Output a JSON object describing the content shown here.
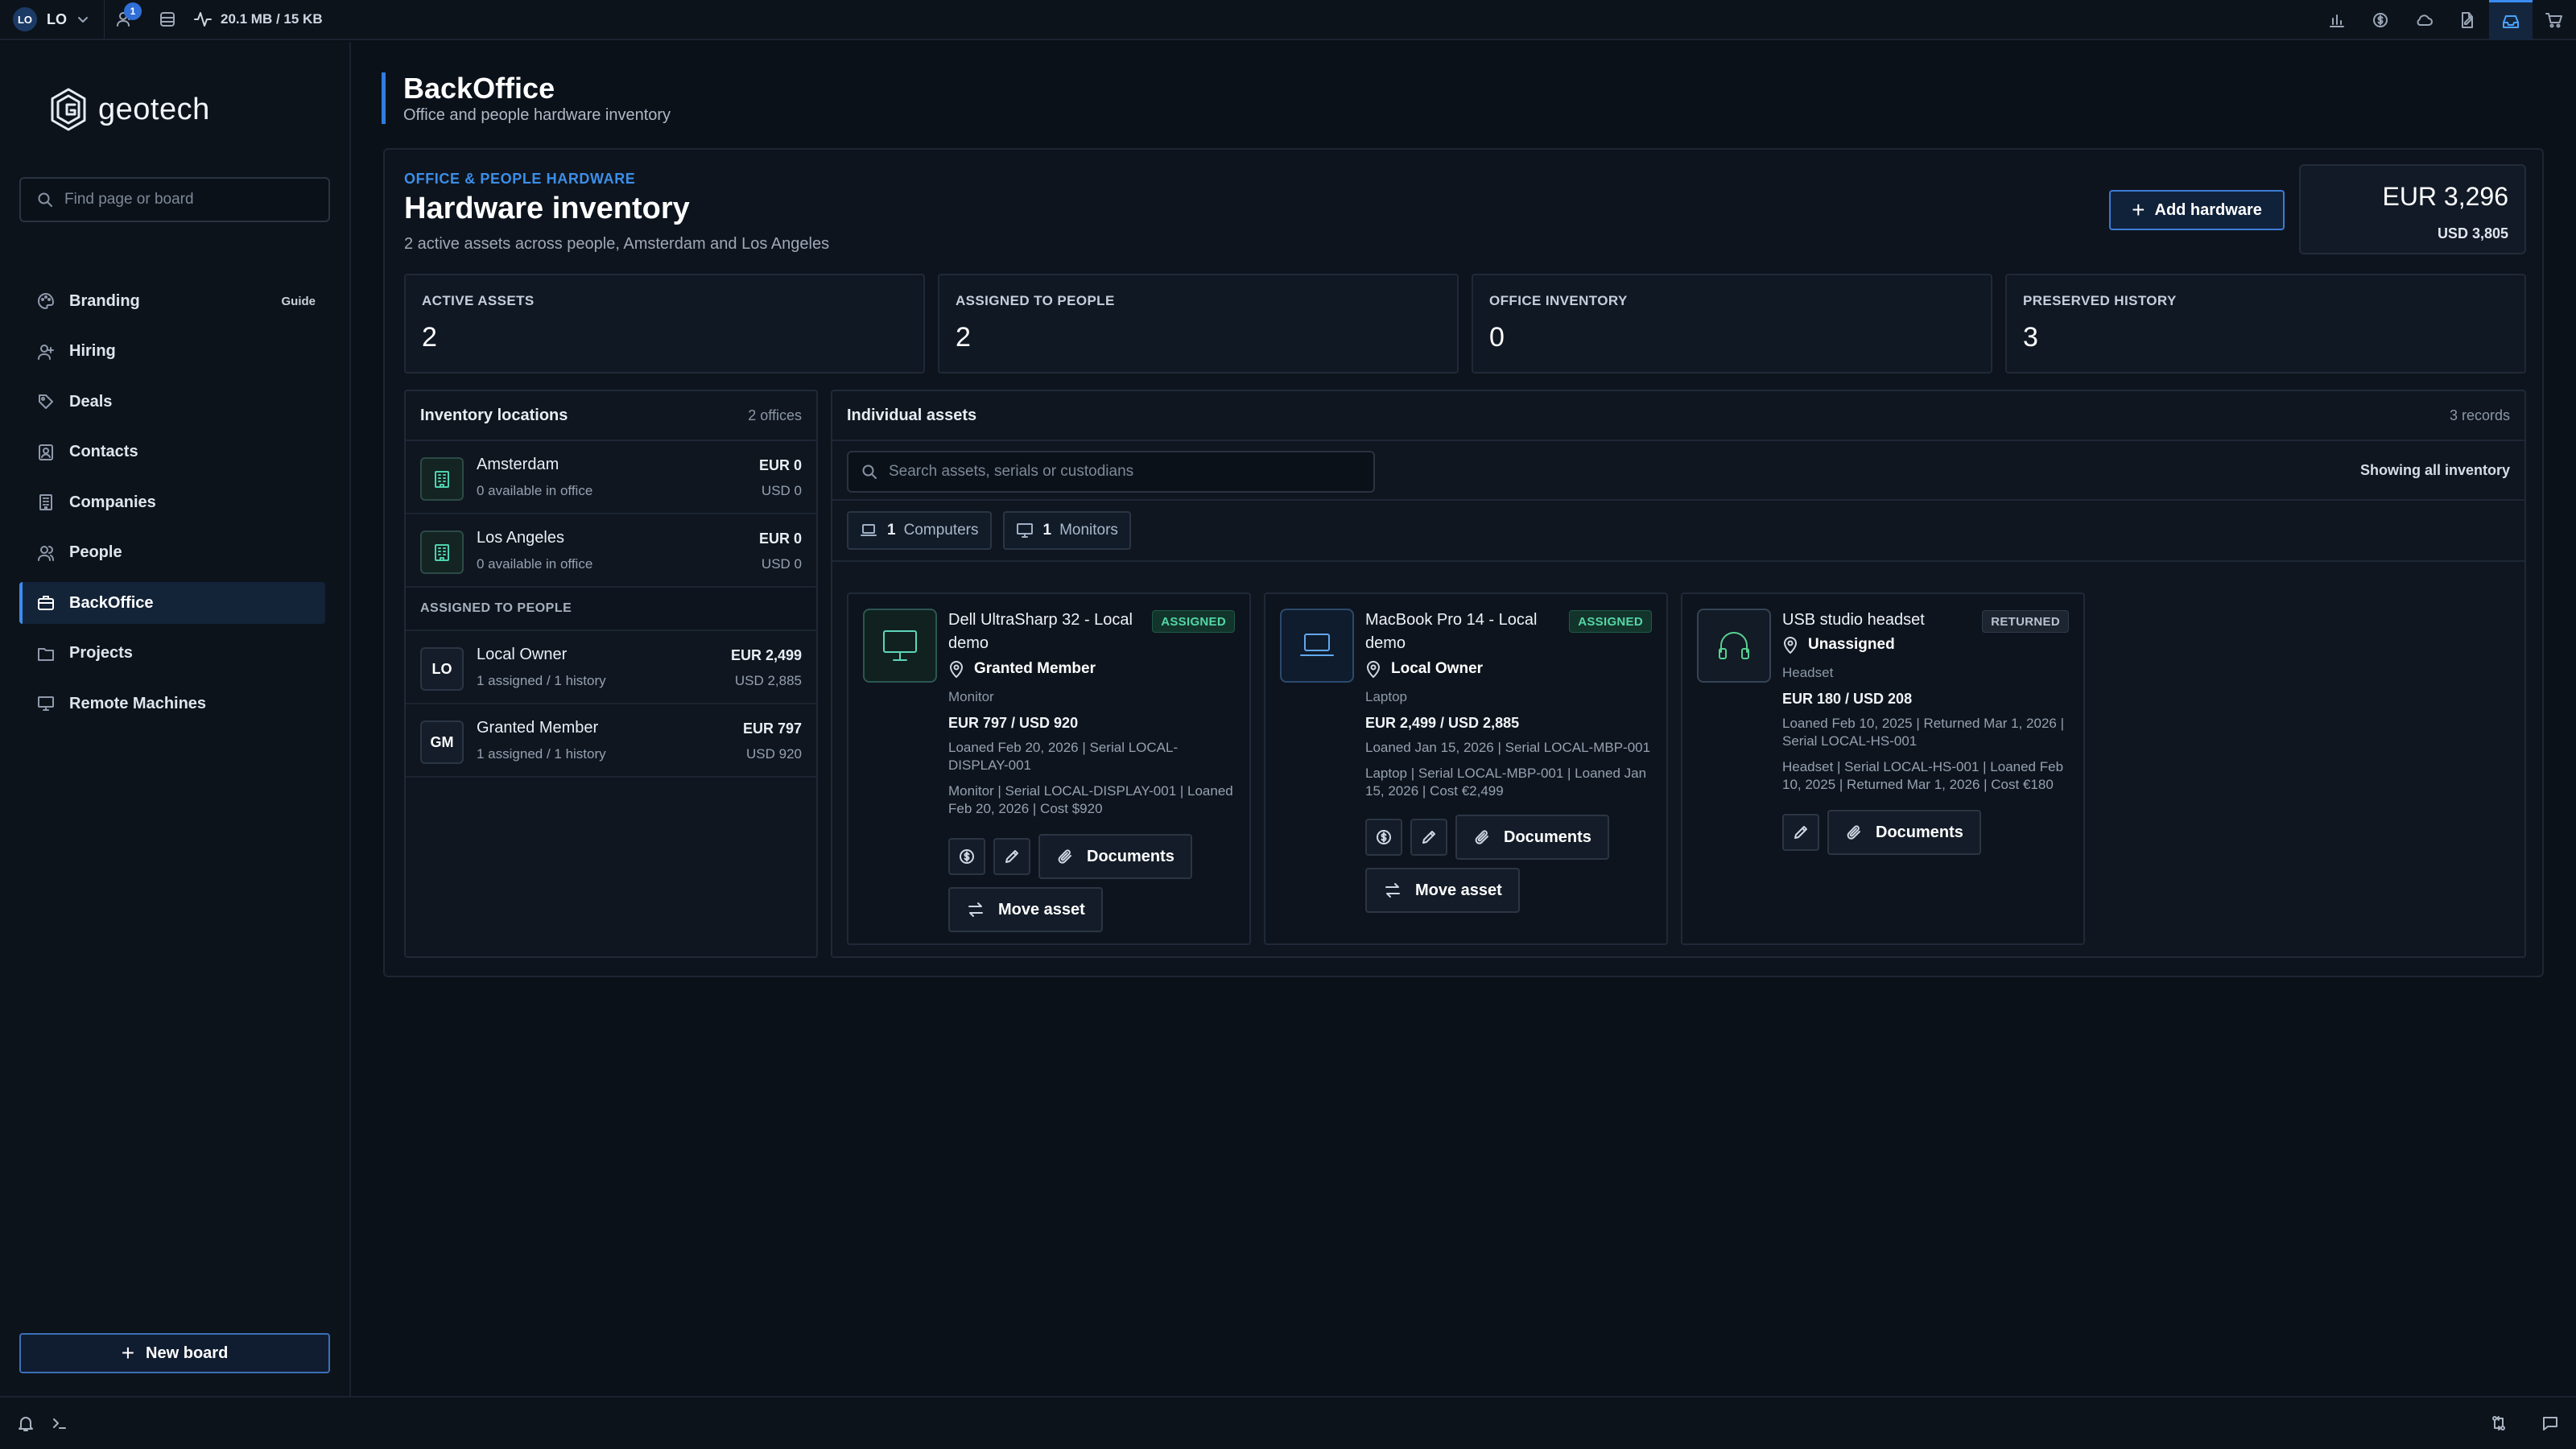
{
  "topbar": {
    "user_initials": "LO",
    "user_label": "LO",
    "notification_count": "1",
    "memory": "20.1 MB / 15 KB"
  },
  "sidebar": {
    "logo_text": "geotech",
    "search_placeholder": "Find page or board",
    "items": [
      {
        "label": "Branding",
        "icon": "palette-icon",
        "extra": "Guide"
      },
      {
        "label": "Hiring",
        "icon": "user-plus-icon"
      },
      {
        "label": "Deals",
        "icon": "tag-icon"
      },
      {
        "label": "Contacts",
        "icon": "contact-card-icon"
      },
      {
        "label": "Companies",
        "icon": "building-icon"
      },
      {
        "label": "People",
        "icon": "people-icon"
      },
      {
        "label": "BackOffice",
        "icon": "briefcase-icon"
      },
      {
        "label": "Projects",
        "icon": "folder-icon"
      },
      {
        "label": "Remote Machines",
        "icon": "monitor-icon"
      }
    ],
    "new_board": "New board"
  },
  "page": {
    "title": "BackOffice",
    "subtitle": "Office and people hardware inventory"
  },
  "header": {
    "eyebrow": "OFFICE & PEOPLE HARDWARE",
    "title": "Hardware inventory",
    "description": "2 active assets across people, Amsterdam and Los Angeles",
    "add_button": "Add hardware",
    "total_eur": "EUR 3,296",
    "total_usd": "USD 3,805"
  },
  "stats": [
    {
      "label": "ACTIVE ASSETS",
      "value": "2"
    },
    {
      "label": "ASSIGNED TO PEOPLE",
      "value": "2"
    },
    {
      "label": "OFFICE INVENTORY",
      "value": "0"
    },
    {
      "label": "PRESERVED HISTORY",
      "value": "3"
    }
  ],
  "locations": {
    "title": "Inventory locations",
    "count": "2 offices",
    "offices": [
      {
        "name": "Amsterdam",
        "sub": "0 available in office",
        "eur": "EUR 0",
        "usd": "USD 0"
      },
      {
        "name": "Los Angeles",
        "sub": "0 available in office",
        "eur": "EUR 0",
        "usd": "USD 0"
      }
    ],
    "people_section": "ASSIGNED TO PEOPLE",
    "people": [
      {
        "initials": "LO",
        "name": "Local Owner",
        "sub": "1 assigned / 1 history",
        "eur": "EUR 2,499",
        "usd": "USD 2,885"
      },
      {
        "initials": "GM",
        "name": "Granted Member",
        "sub": "1 assigned / 1 history",
        "eur": "EUR 797",
        "usd": "USD 920"
      }
    ]
  },
  "assets": {
    "title": "Individual assets",
    "count": "3 records",
    "search_placeholder": "Search assets, serials or custodians",
    "showing": "Showing all inventory",
    "filters": [
      {
        "count": "1",
        "label": "Computers"
      },
      {
        "count": "1",
        "label": "Monitors"
      }
    ],
    "cards": [
      {
        "title": "Dell UltraSharp 32 - Local demo",
        "status": "ASSIGNED",
        "owner": "Granted Member",
        "type": "Monitor",
        "price": "EUR 797 / USD 920",
        "line1": "Loaned Feb 20, 2026 | Serial LOCAL-DISPLAY-001",
        "line2": "Monitor | Serial LOCAL-DISPLAY-001 | Loaned Feb 20, 2026 | Cost $920",
        "documents": "Documents",
        "move": "Move asset"
      },
      {
        "title": "MacBook Pro 14 - Local demo",
        "status": "ASSIGNED",
        "owner": "Local Owner",
        "type": "Laptop",
        "price": "EUR 2,499 / USD 2,885",
        "line1": "Loaned Jan 15, 2026 | Serial LOCAL-MBP-001",
        "line2": "Laptop | Serial LOCAL-MBP-001 | Loaned Jan 15, 2026 | Cost €2,499",
        "documents": "Documents",
        "move": "Move asset"
      },
      {
        "title": "USB studio headset",
        "status": "RETURNED",
        "owner": "Unassigned",
        "type": "Headset",
        "price": "EUR 180 / USD 208",
        "line1": "Loaned Feb 10, 2025 | Returned Mar 1, 2026 | Serial LOCAL-HS-001",
        "line2": "Headset | Serial LOCAL-HS-001 | Loaned Feb 10, 2025 | Returned Mar 1, 2026 | Cost €180",
        "documents": "Documents"
      }
    ]
  }
}
